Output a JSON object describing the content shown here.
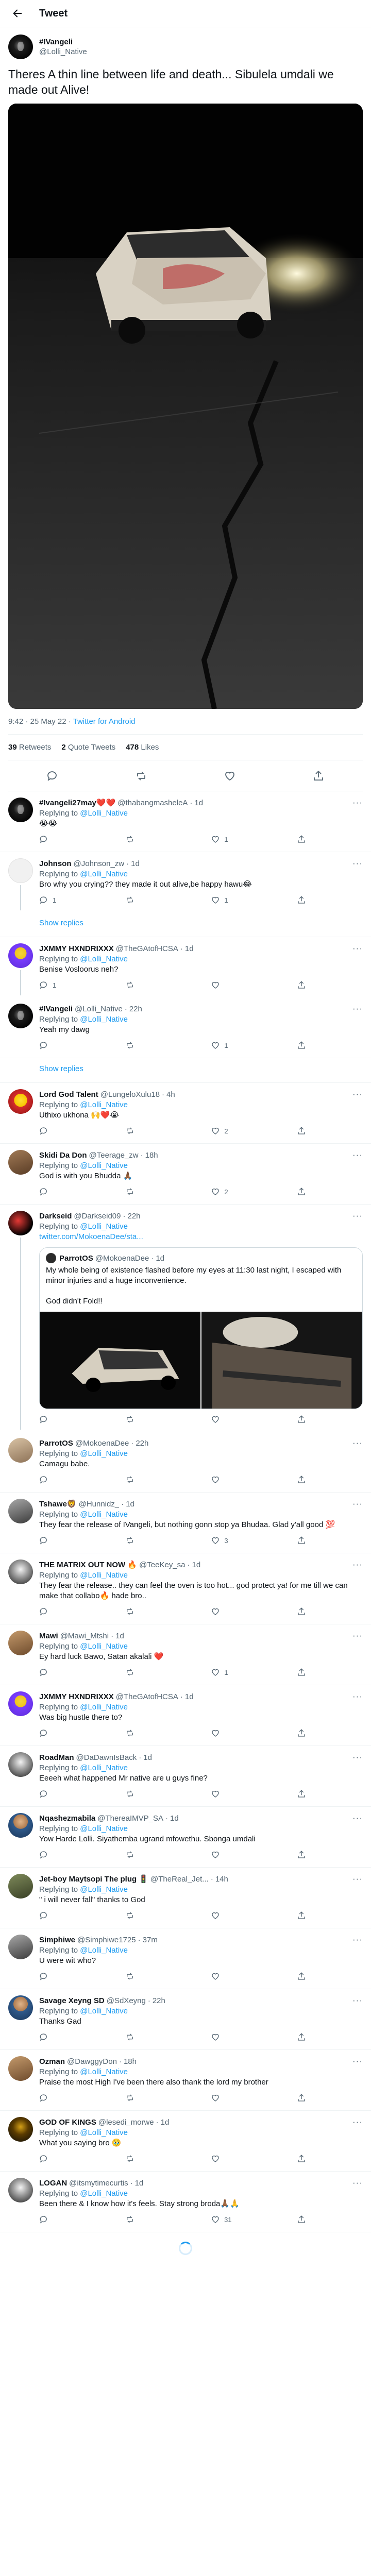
{
  "header": {
    "title": "Tweet"
  },
  "tweet": {
    "name": "#IVangeli",
    "handle": "@Lolli_Native",
    "text": "Theres A thin line between life and death... Sibulela umdali we made out Alive!",
    "time": "9:42 · 25 May 22 · ",
    "app": "Twitter for Android",
    "retweets": "39",
    "retweets_label": "Retweets",
    "quotes": "2",
    "quotes_label": "Quote Tweets",
    "likes": "478",
    "likes_label": "Likes"
  },
  "common": {
    "replying_to": "Replying to ",
    "mention": "@Lolli_Native",
    "more": "···",
    "show_replies": "Show replies"
  },
  "replies": [
    {
      "name": "#Ivangeli27may❤️❤️",
      "handle": "@thabangmasheleA",
      "time": "1d",
      "text": "😭😭",
      "replies": "",
      "rts": "",
      "likes": "1"
    },
    {
      "name": "Johnson",
      "handle": "@Johnson_zw",
      "time": "1d",
      "text": "Bro why you crying?? they made it out alive,be happy hawu😂",
      "replies": "1",
      "rts": "",
      "likes": "1"
    },
    {
      "name": "JXMMY HXNDRIXXX",
      "handle": "@TheGAtofHCSA",
      "time": "1d",
      "text": "Benise Vosloorus  neh?",
      "replies": "1",
      "rts": "",
      "likes": ""
    },
    {
      "name": "#IVangeli",
      "handle": "@Lolli_Native",
      "time": "22h",
      "text": "Yeah my dawg",
      "replies": "",
      "rts": "",
      "likes": "1"
    },
    {
      "name": "Lord God Talent",
      "handle": "@LungeloXulu18",
      "time": "4h",
      "text": "Uthixo ukhona 🙌❤️😭",
      "replies": "",
      "rts": "",
      "likes": "2"
    },
    {
      "name": "Skidi Da Don",
      "handle": "@Teerage_zw",
      "time": "18h",
      "text": "God is with you Bhudda 🙏🏾",
      "replies": "",
      "rts": "",
      "likes": "2"
    },
    {
      "name": "Darkseid",
      "handle": "@Darkseid09",
      "time": "22h",
      "text": "",
      "link": "twitter.com/MokoenaDee/sta...",
      "replies": "",
      "rts": "",
      "likes": ""
    },
    {
      "name": "ParrotOS",
      "handle": "@MokoenaDee",
      "time": "22h",
      "text": "Camagu babe.",
      "replies": "",
      "rts": "",
      "likes": ""
    },
    {
      "name": "Tshawe🦁",
      "handle": "@Hunnidz_",
      "time": "1d",
      "text": "They fear the release of IVangeli, but nothing gonn stop ya Bhudaa. Glad y'all good 💯",
      "replies": "",
      "rts": "",
      "likes": "3"
    },
    {
      "name": "THE MATRIX OUT NOW 🔥",
      "handle": "@TeeKey_sa",
      "time": "1d",
      "text": "They fear the release.. they can feel the oven is too hot... god protect ya! for me till we can make that collabo🔥 hade bro..",
      "replies": "",
      "rts": "",
      "likes": ""
    },
    {
      "name": "Mawi",
      "handle": "@Mawi_Mtshi",
      "time": "1d",
      "text": "Ey hard luck Bawo, Satan akalali ❤️",
      "replies": "",
      "rts": "",
      "likes": "1"
    },
    {
      "name": "JXMMY HXNDRIXXX",
      "handle": "@TheGAtofHCSA",
      "time": "1d",
      "text": "Was big hustle there to?",
      "replies": "",
      "rts": "",
      "likes": ""
    },
    {
      "name": "RoadMan",
      "handle": "@DaDawnIsBack",
      "time": "1d",
      "text": "Eeeeh what happened Mr native are u guys fine?",
      "replies": "",
      "rts": "",
      "likes": ""
    },
    {
      "name": "Nqashezmabila",
      "handle": "@ThereaIMVP_SA",
      "time": "1d",
      "text": "Yow Harde Lolli. Siyathemba ugrand mfowethu. Sbonga umdali",
      "replies": "",
      "rts": "",
      "likes": ""
    },
    {
      "name": "Jet-boy Maytsopi The plug 🚦",
      "handle": "@TheReal_Jet...",
      "time": "14h",
      "text": "\" i will never fall\" thanks to God",
      "replies": "",
      "rts": "",
      "likes": ""
    },
    {
      "name": "Simphiwe",
      "handle": "@Simphiwe1725",
      "time": "37m",
      "text": "U were wit who?",
      "replies": "",
      "rts": "",
      "likes": ""
    },
    {
      "name": "Savage Xeyng SD",
      "handle": "@SdXeyng",
      "time": "22h",
      "text": "Thanks Gad",
      "replies": "",
      "rts": "",
      "likes": ""
    },
    {
      "name": "Ozman",
      "handle": "@DawggyDon",
      "time": "18h",
      "text": "Praise the most High I've been there also thank the lord my brother",
      "replies": "",
      "rts": "",
      "likes": ""
    },
    {
      "name": "GOD OF KINGS",
      "handle": "@lesedi_morwe",
      "time": "1d",
      "text": "What you saying bro 🥹",
      "replies": "",
      "rts": "",
      "likes": ""
    },
    {
      "name": "LOGAN",
      "handle": "@itsmytimecurtis",
      "time": "1d",
      "text": "Been there & I know how it's feels. Stay strong broda🙏🏾🙏",
      "replies": "",
      "rts": "",
      "likes": "31"
    }
  ],
  "quote": {
    "name": "ParrotOS",
    "handle": "@MokoenaDee",
    "time": "1d",
    "text": "My whole being of existence flashed before my eyes at 11:30 last night, I escaped with minor injuries and a huge inconvenience.\n\nGod didn't Fold!!"
  },
  "colors": {
    "accent": "#1d9bf0",
    "text": "#0f1419",
    "muted": "#536471",
    "border": "#eff3f4"
  },
  "icons": [
    "back-arrow-icon",
    "reply-icon",
    "retweet-icon",
    "like-icon",
    "share-icon",
    "more-icon"
  ]
}
